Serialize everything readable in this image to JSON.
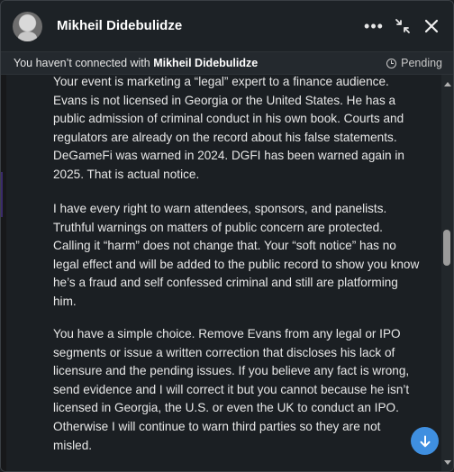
{
  "header": {
    "contact_name": "Mikheil Didebulidze",
    "more_icon": "more-horizontal-icon",
    "collapse_icon": "collapse-icon",
    "close_icon": "close-icon"
  },
  "banner": {
    "prefix": "You haven’t connected with ",
    "name": "Mikheil Didebulidze",
    "status": "Pending",
    "status_icon": "clock-icon"
  },
  "message": {
    "paragraphs": [
      "Your event is marketing a “legal” expert to a finance audience. Evans is not licensed in Georgia or the United States. He has a public admission of criminal conduct in his own book. Courts and regulators are already on the record about his false statements. DeGameFi was warned in 2024. DGFI has been warned again in 2025. That is actual notice.",
      "I have every right to warn attendees, sponsors, and panelists. Truthful warnings on matters of public concern are protected. Calling it “harm” does not change that. Your “soft notice” has no legal effect and will be added to the public record to show you know he’s a fraud and self confessed criminal and still are platforming him.",
      "You have a simple choice. Remove Evans from any legal or IPO segments or issue a written correction that discloses his lack of licensure and the pending issues. If you believe any fact is wrong, send evidence and I will correct it but you cannot because he isn’t licensed in Georgia, the U.S. or even the UK to conduct an IPO. Otherwise I will continue to warn third parties so they are not misled."
    ]
  },
  "jump_button": {
    "icon": "arrow-down-icon",
    "color": "#3f8fe0"
  }
}
